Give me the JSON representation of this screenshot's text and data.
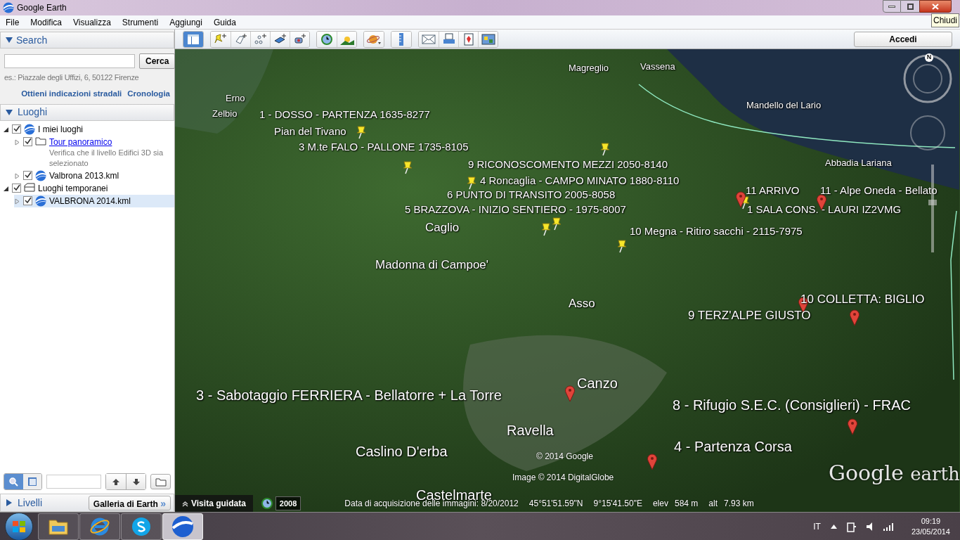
{
  "window": {
    "title": "Google Earth",
    "tooltip": "Chiudi"
  },
  "menu": [
    "File",
    "Modifica",
    "Visualizza",
    "Strumenti",
    "Aggiungi",
    "Guida"
  ],
  "toolbar_groups": [
    [
      {
        "kind": "sidebar",
        "selected": true
      }
    ],
    [
      {
        "kind": "placemark",
        "selected": false
      },
      {
        "kind": "polygon",
        "selected": false
      },
      {
        "kind": "path",
        "selected": false
      },
      {
        "kind": "overlay",
        "selected": false
      },
      {
        "kind": "tour",
        "selected": false
      }
    ],
    [
      {
        "kind": "history",
        "selected": false
      },
      {
        "kind": "sun",
        "selected": false
      }
    ],
    [
      {
        "kind": "planet",
        "selected": false
      }
    ],
    [
      {
        "kind": "ruler",
        "selected": false
      }
    ],
    [
      {
        "kind": "email",
        "selected": false
      },
      {
        "kind": "print",
        "selected": false
      },
      {
        "kind": "maps",
        "selected": false
      },
      {
        "kind": "image",
        "selected": false
      }
    ]
  ],
  "sign_in": "Accedi",
  "search": {
    "title": "Search",
    "expanded": true,
    "button": "Cerca",
    "hint": "es.: Piazzale degli Uffizi, 6, 50122 Firenze",
    "links": [
      "Ottieni indicazioni stradali",
      "Cronologia"
    ]
  },
  "places": {
    "title": "Luoghi",
    "expanded": true,
    "items": [
      {
        "label": "I miei luoghi",
        "kind": "globe",
        "checked": true,
        "expanded": true,
        "selected": false,
        "link": false,
        "children": [
          {
            "label": "Tour panoramico",
            "kind": "folder",
            "checked": true,
            "expanded": false,
            "selected": false,
            "link": true,
            "description": "Verifica che il livello Edifici 3D sia selezionato"
          },
          {
            "label": "Valbrona 2013.kml",
            "kind": "globe",
            "checked": true,
            "expanded": false,
            "selected": false,
            "link": false
          }
        ]
      },
      {
        "label": "Luoghi temporanei",
        "kind": "tray",
        "checked": true,
        "expanded": true,
        "selected": false,
        "link": false,
        "children": [
          {
            "label": "VALBRONA 2014.kml",
            "kind": "globe",
            "checked": true,
            "expanded": false,
            "selected": true,
            "link": false
          }
        ]
      }
    ]
  },
  "view_toggle": [
    {
      "kind": "search",
      "selected": true
    },
    {
      "kind": "panel",
      "selected": false
    }
  ],
  "layers": {
    "title": "Livelli",
    "expanded": false,
    "gallery_button": "Galleria di Earth",
    "gallery_arrows": "»"
  },
  "map": {
    "labels": [
      {
        "text": "Magreglio",
        "kind": "place"
      },
      {
        "text": "Vassena",
        "kind": "place"
      },
      {
        "text": "Erno",
        "kind": "place"
      },
      {
        "text": "Zelbio",
        "kind": "place"
      },
      {
        "text": "1 - DOSSO - PARTENZA 1635-8277",
        "kind": "mark"
      },
      {
        "text": "Pian del Tivano",
        "kind": "mark"
      },
      {
        "text": "3 M.te FALO - PALLONE 1735-8105",
        "kind": "mark"
      },
      {
        "text": "Mandello del Lario",
        "kind": "place"
      },
      {
        "text": "Abbadia Lariana",
        "kind": "place"
      },
      {
        "text": "9 RICONOSCOMENTO MEZZI 2050-8140",
        "kind": "mark"
      },
      {
        "text": "4 Roncaglia - CAMPO MINATO 1880-8110",
        "kind": "mark"
      },
      {
        "text": "6 PUNTO DI TRANSITO 2005-8058",
        "kind": "mark"
      },
      {
        "text": "5 BRAZZOVA - INIZIO SENTIERO - 1975-8007",
        "kind": "mark"
      },
      {
        "text": "11 ARRIVO",
        "kind": "mark"
      },
      {
        "text": "11 - Alpe Oneda - Bellato",
        "kind": "mark"
      },
      {
        "text": "1 SALA CONS. - LAURI IZ2VMG",
        "kind": "mark"
      },
      {
        "text": "Caglio",
        "kind": "town"
      },
      {
        "text": "10 Megna - Ritiro sacchi - 2115-7975",
        "kind": "mark"
      },
      {
        "text": "Madonna di Campoe'",
        "kind": "town"
      },
      {
        "text": "Asso",
        "kind": "town"
      },
      {
        "text": "10 COLLETTA: BIGLIO",
        "kind": "town"
      },
      {
        "text": "9 TERZ'ALPE GIUSTO",
        "kind": "town"
      },
      {
        "text": "Canzo",
        "kind": "city"
      },
      {
        "text": "3 - Sabotaggio FERRIERA - Bellatorre + La Torre",
        "kind": "city"
      },
      {
        "text": "8 - Rifugio S.E.C. (Consiglieri) - FRAC",
        "kind": "city"
      },
      {
        "text": "Ravella",
        "kind": "city"
      },
      {
        "text": "Caslino D'erba",
        "kind": "city"
      },
      {
        "text": "4 - Partenza Corsa",
        "kind": "city"
      },
      {
        "text": "Castelmarte",
        "kind": "city"
      }
    ],
    "copyright": [
      "© 2014 Google",
      "Image © 2014 DigitalGlobe"
    ],
    "logo": [
      "Google",
      "earth"
    ],
    "compass_letter": "N",
    "tour_button": "Visita guidata",
    "year": "2008",
    "status": [
      "Data di acquisizione delle immagini: 8/20/2012",
      "45°51'51.59\"N",
      "9°15'41.50\"E",
      "elev",
      "584 m",
      "alt",
      "7.93 km"
    ]
  },
  "taskbar": {
    "apps": [
      {
        "kind": "explorer",
        "selected": false
      },
      {
        "kind": "ie",
        "selected": false
      },
      {
        "kind": "skype",
        "selected": false
      },
      {
        "kind": "earth",
        "selected": true
      }
    ],
    "language": "IT",
    "time": "09:19",
    "date": "23/05/2014"
  }
}
